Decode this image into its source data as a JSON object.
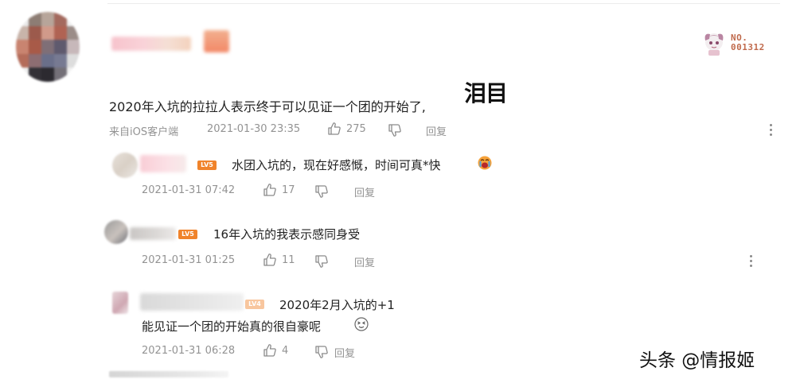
{
  "main_comment": {
    "text": "2020年入坑的拉拉人表示终于可以见证一个团的开始了,",
    "sticker_text": "泪目",
    "source": "来自iOS客户端",
    "time": "2021-01-30 23:35",
    "likes": "275",
    "reply_label": "回复",
    "badge_no": "NO.",
    "badge_number": "001312"
  },
  "replies": [
    {
      "text": "水团入坑的，现在好感慨，时间可真*快",
      "level": "LV5",
      "time": "2021-01-31 07:42",
      "likes": "17",
      "reply_label": "回复"
    },
    {
      "text": "16年入坑的我表示感同身受",
      "level": "LV5",
      "time": "2021-01-31 01:25",
      "likes": "11",
      "reply_label": "回复"
    },
    {
      "text": "2020年2月入坑的+1",
      "text_line2": "能见证一个团的开始真的很自豪呢",
      "level": "LV4",
      "time": "2021-01-31 06:28",
      "likes": "4",
      "reply_label": "回复"
    }
  ],
  "watermark": "头条 @情报姬",
  "colors": {
    "meta_gray": "#939393",
    "level_badge": "#f0832b",
    "text": "#222222"
  }
}
